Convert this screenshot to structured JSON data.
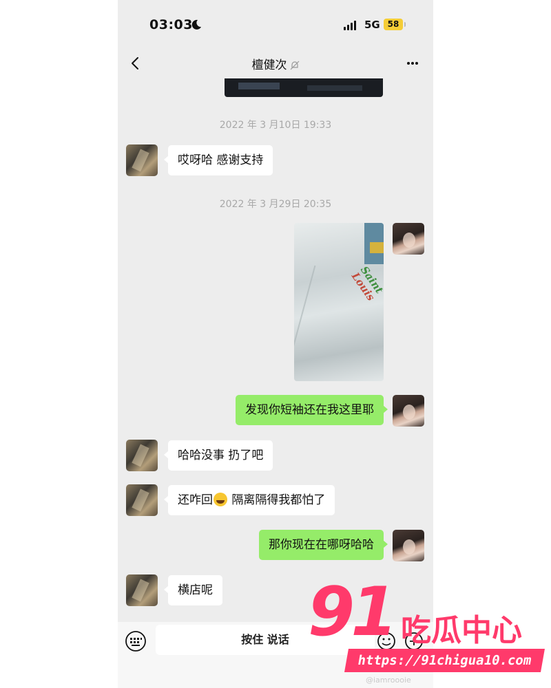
{
  "status_bar": {
    "time": "03:03",
    "network": "5G",
    "battery": "58"
  },
  "header": {
    "title": "檀健次"
  },
  "timestamps": [
    "2022 年 3 月10日 19:33",
    "2022 年 3 月29日 20:35"
  ],
  "messages": [
    {
      "side": "left",
      "text": "哎呀哈 感谢支持"
    },
    {
      "side": "right",
      "type": "image",
      "shirt_print": [
        "Saint",
        "Louis"
      ]
    },
    {
      "side": "right",
      "text": "发现你短袖还在我这里耶"
    },
    {
      "side": "left",
      "text": "哈哈没事 扔了吧"
    },
    {
      "side": "left",
      "text_before": "还咋回",
      "emoji": "laughing-emoji",
      "text_after": " 隔离隔得我都怕了"
    },
    {
      "side": "right",
      "text": "那你现在在哪呀哈哈"
    },
    {
      "side": "left",
      "text": "横店呢"
    }
  ],
  "input_bar": {
    "hold_to_talk": "按住 说话"
  },
  "watermark": {
    "number": "91",
    "brand": "吃瓜中心",
    "url": "https://91chigua10.com",
    "weibo_handle": "@iamroooie"
  },
  "colors": {
    "right_bubble": "#95ec69",
    "left_bubble": "#ffffff",
    "background": "#ededed",
    "watermark": "#ff3a6b"
  }
}
